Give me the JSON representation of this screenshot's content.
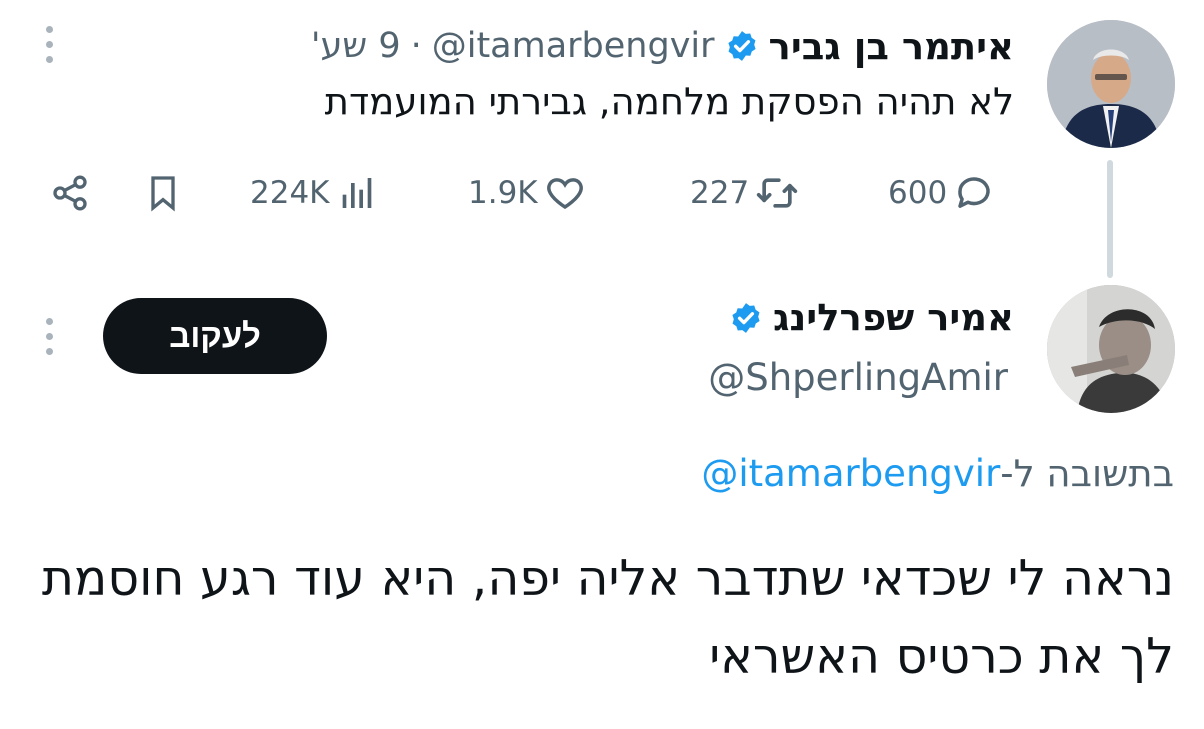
{
  "tweet1": {
    "author_name": "איתמר בן גביר",
    "handle": "@itamarbengvir",
    "dot": "·",
    "time": "9 שע'",
    "text": "לא תהיה הפסקת מלחמה, גבירתי המועמדת",
    "actions": {
      "replies": "600",
      "reposts": "227",
      "likes": "1.9K",
      "views": "224K"
    }
  },
  "tweet2": {
    "author_name": "אמיר שפרלינג",
    "handle": "@ShperlingAmir",
    "follow_label": "לעקוב",
    "reply_prefix": "בתשובה ל-",
    "reply_mention": "@itamarbengvir",
    "text": "נראה לי שכדאי שתדבר אליה יפה, היא עוד רגע חוסמת לך את כרטיס האשראי"
  },
  "colors": {
    "accent": "#1d9bf0",
    "muted": "#536471",
    "text": "#0f1419",
    "follow_bg": "#0f1419",
    "thread_line": "#cfd9de"
  },
  "icons": [
    "share-icon",
    "bookmark-icon",
    "views-icon",
    "like-icon",
    "repost-icon",
    "reply-icon",
    "verified-badge-icon",
    "more-icon"
  ]
}
